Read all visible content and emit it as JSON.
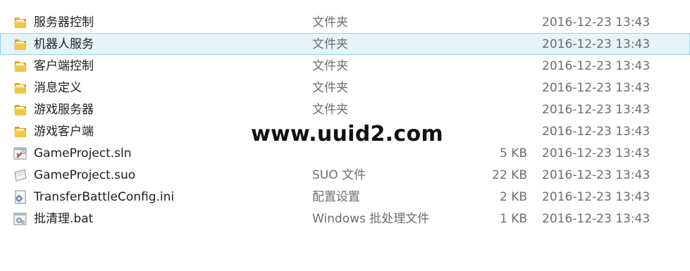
{
  "files": [
    {
      "name": "服务器控制",
      "type": "文件夹",
      "size": "",
      "date": "2016-12-23 13:43",
      "icon": "folder-icon",
      "selected": false
    },
    {
      "name": "机器人服务",
      "type": "文件夹",
      "size": "",
      "date": "2016-12-23 13:43",
      "icon": "folder-icon",
      "selected": true
    },
    {
      "name": "客户端控制",
      "type": "文件夹",
      "size": "",
      "date": "2016-12-23 13:43",
      "icon": "folder-icon",
      "selected": false
    },
    {
      "name": "消息定义",
      "type": "文件夹",
      "size": "",
      "date": "2016-12-23 13:43",
      "icon": "folder-icon",
      "selected": false
    },
    {
      "name": "游戏服务器",
      "type": "文件夹",
      "size": "",
      "date": "2016-12-23 13:43",
      "icon": "folder-icon",
      "selected": false
    },
    {
      "name": "游戏客户端",
      "type": "",
      "size": "",
      "date": "2016-12-23 13:43",
      "icon": "folder-icon",
      "selected": false
    },
    {
      "name": "GameProject.sln",
      "type": "",
      "size": "5 KB",
      "date": "2016-12-23 13:43",
      "icon": "sln-file-icon",
      "selected": false
    },
    {
      "name": "GameProject.suo",
      "type": "SUO 文件",
      "size": "22 KB",
      "date": "2016-12-23 13:43",
      "icon": "suo-file-icon",
      "selected": false
    },
    {
      "name": "TransferBattleConfig.ini",
      "type": "配置设置",
      "size": "2 KB",
      "date": "2016-12-23 13:43",
      "icon": "ini-file-icon",
      "selected": false
    },
    {
      "name": "批清理.bat",
      "type": "Windows 批处理文件",
      "size": "1 KB",
      "date": "2016-12-23 13:43",
      "icon": "bat-file-icon",
      "selected": false
    }
  ],
  "watermark": {
    "text": "www.uuid2.com"
  },
  "colors": {
    "selection_background": "#e5f3fb",
    "selection_border": "#99d1ef",
    "folder_yellow": "#f2c744",
    "secondary_text": "#6d6d6d"
  }
}
